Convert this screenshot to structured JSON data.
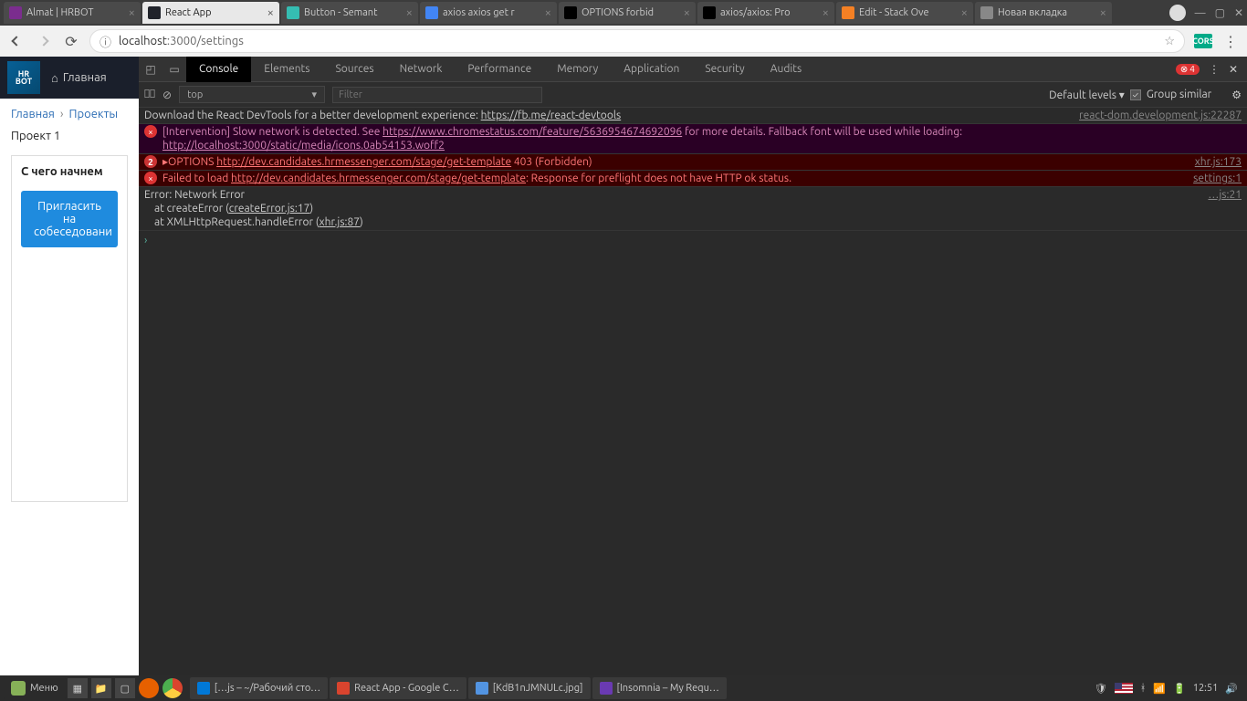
{
  "browser": {
    "tabs": [
      {
        "title": "Almat | HRBOT",
        "icon_bg": "#7b2d8e"
      },
      {
        "title": "React App",
        "icon_bg": "#20232a",
        "active": true
      },
      {
        "title": "Button - Semant",
        "icon_bg": "#35bdb2"
      },
      {
        "title": "axios axios get r",
        "icon_bg": "#4285f4"
      },
      {
        "title": "OPTIONS forbid",
        "icon_bg": "#000"
      },
      {
        "title": "axios/axios: Pro",
        "icon_bg": "#000"
      },
      {
        "title": "Edit - Stack Ove",
        "icon_bg": "#f48024"
      },
      {
        "title": "Новая вкладка",
        "icon_bg": "#888"
      }
    ],
    "url_host": "localhost",
    "url_port": ":3000",
    "url_path": "/settings",
    "ext_label": "CORS"
  },
  "page": {
    "logo_top": "HR",
    "logo_bot": "BOT",
    "home": "Главная",
    "bc1": "Главная",
    "bc2": "Проекты",
    "project": "Проект 1",
    "card_title": "С чего начнем",
    "invite": "Пригласить на собеседовани"
  },
  "devtools": {
    "tabs": [
      "Console",
      "Elements",
      "Sources",
      "Network",
      "Performance",
      "Memory",
      "Application",
      "Security",
      "Audits"
    ],
    "active_tab": "Console",
    "error_count": "4",
    "context": "top",
    "filter_ph": "Filter",
    "levels": "Default levels",
    "group": "Group similar",
    "messages": [
      {
        "type": "plain",
        "text": "Download the React DevTools for a better development experience: ",
        "link": "https://fb.me/react-devtools",
        "src": "react-dom.development.js:22287"
      },
      {
        "type": "vio",
        "icon": "e",
        "text": "[Intervention] Slow network is detected. See ",
        "link": "https://www.chromestatus.com/feature/5636954674692096",
        "after": " for more details. Fallback font will be used while loading: ",
        "link2": "http://localhost:3000/static/media/icons.0ab54153.woff2"
      },
      {
        "type": "err",
        "icon": "n",
        "count": "2",
        "pre": "▸OPTIONS ",
        "link": "http://dev.candidates.hrmessenger.com/stage/get-template",
        "after": " 403 (Forbidden)",
        "src": "xhr.js:173"
      },
      {
        "type": "err",
        "icon": "e",
        "text": "Failed to load ",
        "link": "http://dev.candidates.hrmessenger.com/stage/get-template",
        "after": ": Response for preflight does not have HTTP ok status.",
        "src": "settings:1"
      },
      {
        "type": "trace",
        "text": "Error: Network Error\n    at createError (",
        "link": "createError.js:17",
        "after": ")\n    at XMLHttpRequest.handleError (",
        "link2": "xhr.js:87",
        "after2": ")",
        "src": "…js:21"
      }
    ]
  },
  "taskbar": {
    "menu": "Меню",
    "items": [
      {
        "label": "[…js – ~/Рабочий сто…",
        "icon": "#0078d7"
      },
      {
        "label": "React App - Google C…",
        "icon": "#d9442e"
      },
      {
        "label": "[KdB1nJMNULc.jpg]",
        "icon": "#5294e2"
      },
      {
        "label": "[Insomnia – My Requ…",
        "icon": "#6a3ab2"
      }
    ],
    "clock": "12:51"
  }
}
